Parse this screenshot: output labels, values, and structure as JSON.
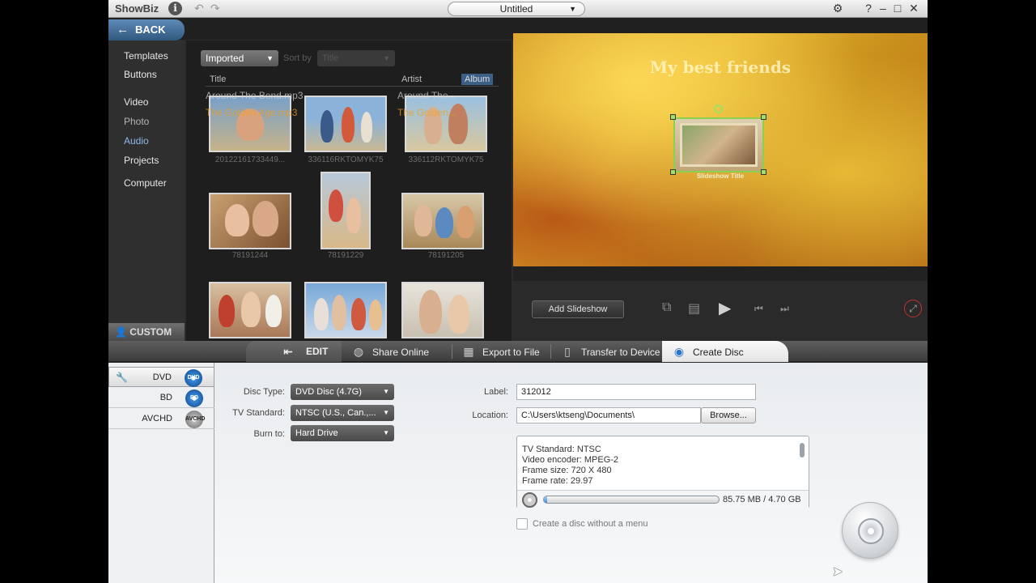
{
  "app": {
    "name": "ShowBiz",
    "title": "Untitled"
  },
  "nav": {
    "back": "BACK",
    "items": [
      "Templates",
      "Buttons",
      "Video",
      "Photo",
      "Audio",
      "Projects",
      "Computer"
    ],
    "active": "Audio",
    "custom": "CUSTOM"
  },
  "library": {
    "filter": "Imported",
    "sort_label": "Sort by",
    "sort_value": "Title",
    "columns": {
      "title": "Title",
      "artist": "Artist",
      "album": "Album"
    },
    "audio": [
      {
        "title": "Around The Bend.mp3",
        "artist": "Around The..."
      },
      {
        "title": "The Golden Age.mp3",
        "artist": "The Golden..."
      }
    ],
    "thumbnails": [
      {
        "caption": "20122161733449..."
      },
      {
        "caption": "336116RKTOMYK75"
      },
      {
        "caption": "336112RKTOMYK75"
      },
      {
        "caption": "78191244"
      },
      {
        "caption": "78191229"
      },
      {
        "caption": "78191205"
      },
      {
        "caption": ""
      },
      {
        "caption": ""
      },
      {
        "caption": ""
      }
    ]
  },
  "preview": {
    "title": "My best friends",
    "slideshow_title": "Slideshow Title"
  },
  "controls": {
    "add_slideshow": "Add Slideshow"
  },
  "tabs": {
    "edit": "EDIT",
    "share_online": "Share Online",
    "export_to_file": "Export to File",
    "transfer_to_device": "Transfer to Device",
    "create_disc": "Create Disc",
    "active": "Create Disc"
  },
  "disc": {
    "types": [
      {
        "label": "DVD",
        "icon": "DVD"
      },
      {
        "label": "BD",
        "icon": "BD"
      },
      {
        "label": "AVCHD",
        "icon": "AVCHD"
      }
    ],
    "selected": "DVD",
    "form": {
      "disc_type_label": "Disc Type:",
      "disc_type_value": "DVD Disc (4.7G)",
      "tv_standard_label": "TV Standard:",
      "tv_standard_value": "NTSC (U.S., Can.,...",
      "burn_to_label": "Burn to:",
      "burn_to_value": "Hard Drive",
      "label_label": "Label:",
      "label_value": "312012",
      "location_label": "Location:",
      "location_value": "C:\\Users\\ktseng\\Documents\\",
      "browse": "Browse..."
    },
    "info": [
      "TV Standard: NTSC",
      "Video encoder: MPEG-2",
      "Frame size: 720 X 480",
      "Frame rate: 29.97"
    ],
    "usage_text": "85.75 MB / 4.70 GB",
    "usage_fraction": 0.018,
    "no_menu_label": "Create a disc without a menu",
    "no_menu_checked": false
  }
}
